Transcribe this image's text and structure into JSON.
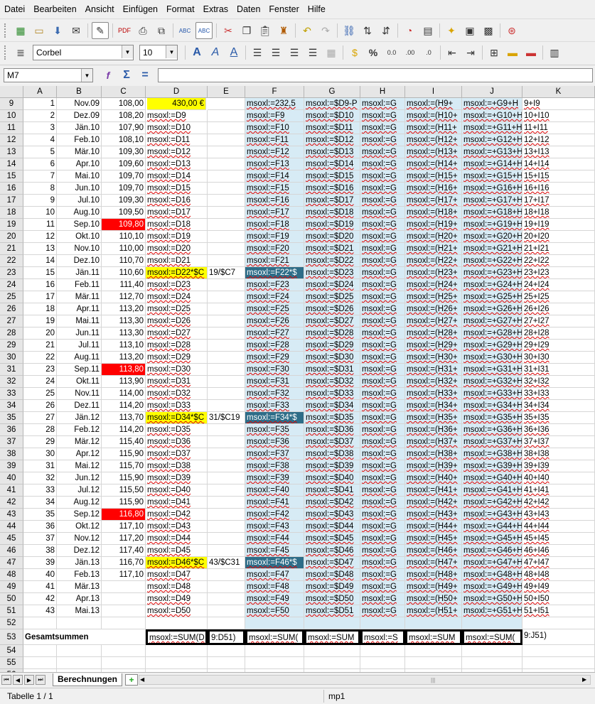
{
  "menu": [
    "Datei",
    "Bearbeiten",
    "Ansicht",
    "Einfügen",
    "Format",
    "Extras",
    "Daten",
    "Fenster",
    "Hilfe"
  ],
  "font_name": "Corbel",
  "font_size": "10",
  "name_box": "M7",
  "formula": "",
  "columns": [
    "A",
    "B",
    "C",
    "D",
    "E",
    "F",
    "G",
    "H",
    "I",
    "J",
    "K"
  ],
  "rows": [
    {
      "n": "9",
      "a": "1",
      "b": "Nov.09",
      "c": "108,00",
      "d": "430,00 €",
      "f": "msoxl:=232,5",
      "g": "msoxl:=$D9-P",
      "h": "msoxl:=G",
      "i": "msoxl:=(H9+",
      "j": "msoxl:=+G9+H",
      "k": "9+I9"
    },
    {
      "n": "10",
      "a": "2",
      "b": "Dez.09",
      "c": "108,20",
      "d": "msoxl:=D9",
      "f": "msoxl:=F9",
      "g": "msoxl:=$D10",
      "h": "msoxl:=G",
      "i": "msoxl:=(H10+",
      "j": "msoxl:=+G10+H",
      "k": "10+I10"
    },
    {
      "n": "11",
      "a": "3",
      "b": "Jän.10",
      "c": "107,90",
      "d": "msoxl:=D10",
      "f": "msoxl:=F10",
      "g": "msoxl:=$D11",
      "h": "msoxl:=G",
      "i": "msoxl:=(H11+",
      "j": "msoxl:=+G11+H",
      "k": "11+I11"
    },
    {
      "n": "12",
      "a": "4",
      "b": "Feb.10",
      "c": "108,10",
      "d": "msoxl:=D11",
      "f": "msoxl:=F11",
      "g": "msoxl:=$D12",
      "h": "msoxl:=G",
      "i": "msoxl:=(H12+",
      "j": "msoxl:=+G12+H",
      "k": "12+I12"
    },
    {
      "n": "13",
      "a": "5",
      "b": "Mär.10",
      "c": "109,30",
      "d": "msoxl:=D12",
      "f": "msoxl:=F12",
      "g": "msoxl:=$D13",
      "h": "msoxl:=G",
      "i": "msoxl:=(H13+",
      "j": "msoxl:=+G13+H",
      "k": "13+I13"
    },
    {
      "n": "14",
      "a": "6",
      "b": "Apr.10",
      "c": "109,60",
      "d": "msoxl:=D13",
      "f": "msoxl:=F13",
      "g": "msoxl:=$D14",
      "h": "msoxl:=G",
      "i": "msoxl:=(H14+",
      "j": "msoxl:=+G14+H",
      "k": "14+I14"
    },
    {
      "n": "15",
      "a": "7",
      "b": "Mai.10",
      "c": "109,70",
      "d": "msoxl:=D14",
      "f": "msoxl:=F14",
      "g": "msoxl:=$D15",
      "h": "msoxl:=G",
      "i": "msoxl:=(H15+",
      "j": "msoxl:=+G15+H",
      "k": "15+I15"
    },
    {
      "n": "16",
      "a": "8",
      "b": "Jun.10",
      "c": "109,70",
      "d": "msoxl:=D15",
      "f": "msoxl:=F15",
      "g": "msoxl:=$D16",
      "h": "msoxl:=G",
      "i": "msoxl:=(H16+",
      "j": "msoxl:=+G16+H",
      "k": "16+I16"
    },
    {
      "n": "17",
      "a": "9",
      "b": "Jul.10",
      "c": "109,30",
      "d": "msoxl:=D16",
      "f": "msoxl:=F16",
      "g": "msoxl:=$D17",
      "h": "msoxl:=G",
      "i": "msoxl:=(H17+",
      "j": "msoxl:=+G17+H",
      "k": "17+I17"
    },
    {
      "n": "18",
      "a": "10",
      "b": "Aug.10",
      "c": "109,50",
      "d": "msoxl:=D17",
      "f": "msoxl:=F17",
      "g": "msoxl:=$D18",
      "h": "msoxl:=G",
      "i": "msoxl:=(H18+",
      "j": "msoxl:=+G18+H",
      "k": "18+I18"
    },
    {
      "n": "19",
      "a": "11",
      "b": "Sep.10",
      "c": "109,80",
      "cred": true,
      "d": "msoxl:=D18",
      "f": "msoxl:=F18",
      "g": "msoxl:=$D19",
      "h": "msoxl:=G",
      "i": "msoxl:=(H19+",
      "j": "msoxl:=+G19+H",
      "k": "19+I19"
    },
    {
      "n": "20",
      "a": "12",
      "b": "Okt.10",
      "c": "110,10",
      "d": "msoxl:=D19",
      "f": "msoxl:=F19",
      "g": "msoxl:=$D20",
      "h": "msoxl:=G",
      "i": "msoxl:=(H20+",
      "j": "msoxl:=+G20+H",
      "k": "20+I20"
    },
    {
      "n": "21",
      "a": "13",
      "b": "Nov.10",
      "c": "110,00",
      "d": "msoxl:=D20",
      "f": "msoxl:=F20",
      "g": "msoxl:=$D21",
      "h": "msoxl:=G",
      "i": "msoxl:=(H21+",
      "j": "msoxl:=+G21+H",
      "k": "21+I21"
    },
    {
      "n": "22",
      "a": "14",
      "b": "Dez.10",
      "c": "110,70",
      "d": "msoxl:=D21",
      "f": "msoxl:=F21",
      "g": "msoxl:=$D22",
      "h": "msoxl:=G",
      "i": "msoxl:=(H22+",
      "j": "msoxl:=+G22+H",
      "k": "22+I22"
    },
    {
      "n": "23",
      "a": "15",
      "b": "Jän.11",
      "c": "110,60",
      "d": "msoxl:=D22*$C",
      "dyel": true,
      "e": "19/$C7",
      "f": "msoxl:=F22*$",
      "fdk": true,
      "g": "msoxl:=$D23",
      "h": "msoxl:=G",
      "i": "msoxl:=(H23+",
      "j": "msoxl:=+G23+H",
      "k": "23+I23"
    },
    {
      "n": "24",
      "a": "16",
      "b": "Feb.11",
      "c": "111,40",
      "d": "msoxl:=D23",
      "f": "msoxl:=F23",
      "g": "msoxl:=$D24",
      "h": "msoxl:=G",
      "i": "msoxl:=(H24+",
      "j": "msoxl:=+G24+H",
      "k": "24+I24"
    },
    {
      "n": "25",
      "a": "17",
      "b": "Mär.11",
      "c": "112,70",
      "d": "msoxl:=D24",
      "f": "msoxl:=F24",
      "g": "msoxl:=$D25",
      "h": "msoxl:=G",
      "i": "msoxl:=(H25+",
      "j": "msoxl:=+G25+H",
      "k": "25+I25"
    },
    {
      "n": "26",
      "a": "18",
      "b": "Apr.11",
      "c": "113,20",
      "d": "msoxl:=D25",
      "f": "msoxl:=F25",
      "g": "msoxl:=$D26",
      "h": "msoxl:=G",
      "i": "msoxl:=(H26+",
      "j": "msoxl:=+G26+H",
      "k": "26+I26"
    },
    {
      "n": "27",
      "a": "19",
      "b": "Mai.11",
      "c": "113,30",
      "d": "msoxl:=D26",
      "f": "msoxl:=F26",
      "g": "msoxl:=$D27",
      "h": "msoxl:=G",
      "i": "msoxl:=(H27+",
      "j": "msoxl:=+G27+H",
      "k": "27+I27"
    },
    {
      "n": "28",
      "a": "20",
      "b": "Jun.11",
      "c": "113,30",
      "d": "msoxl:=D27",
      "f": "msoxl:=F27",
      "g": "msoxl:=$D28",
      "h": "msoxl:=G",
      "i": "msoxl:=(H28+",
      "j": "msoxl:=+G28+H",
      "k": "28+I28"
    },
    {
      "n": "29",
      "a": "21",
      "b": "Jul.11",
      "c": "113,10",
      "d": "msoxl:=D28",
      "f": "msoxl:=F28",
      "g": "msoxl:=$D29",
      "h": "msoxl:=G",
      "i": "msoxl:=(H29+",
      "j": "msoxl:=+G29+H",
      "k": "29+I29"
    },
    {
      "n": "30",
      "a": "22",
      "b": "Aug.11",
      "c": "113,20",
      "d": "msoxl:=D29",
      "f": "msoxl:=F29",
      "g": "msoxl:=$D30",
      "h": "msoxl:=G",
      "i": "msoxl:=(H30+",
      "j": "msoxl:=+G30+H",
      "k": "30+I30"
    },
    {
      "n": "31",
      "a": "23",
      "b": "Sep.11",
      "c": "113,80",
      "cred": true,
      "d": "msoxl:=D30",
      "f": "msoxl:=F30",
      "g": "msoxl:=$D31",
      "h": "msoxl:=G",
      "i": "msoxl:=(H31+",
      "j": "msoxl:=+G31+H",
      "k": "31+I31"
    },
    {
      "n": "32",
      "a": "24",
      "b": "Okt.11",
      "c": "113,90",
      "d": "msoxl:=D31",
      "f": "msoxl:=F31",
      "g": "msoxl:=$D32",
      "h": "msoxl:=G",
      "i": "msoxl:=(H32+",
      "j": "msoxl:=+G32+H",
      "k": "32+I32"
    },
    {
      "n": "33",
      "a": "25",
      "b": "Nov.11",
      "c": "114,00",
      "d": "msoxl:=D32",
      "f": "msoxl:=F32",
      "g": "msoxl:=$D33",
      "h": "msoxl:=G",
      "i": "msoxl:=(H33+",
      "j": "msoxl:=+G33+H",
      "k": "33+I33"
    },
    {
      "n": "34",
      "a": "26",
      "b": "Dez.11",
      "c": "114,20",
      "d": "msoxl:=D33",
      "f": "msoxl:=F33",
      "g": "msoxl:=$D34",
      "h": "msoxl:=G",
      "i": "msoxl:=(H34+",
      "j": "msoxl:=+G34+H",
      "k": "34+I34"
    },
    {
      "n": "35",
      "a": "27",
      "b": "Jän.12",
      "c": "113,70",
      "d": "msoxl:=D34*$C",
      "dyel": true,
      "e": "31/$C19",
      "f": "msoxl:=F34*$",
      "fdk": true,
      "g": "msoxl:=$D35",
      "h": "msoxl:=G",
      "i": "msoxl:=(H35+",
      "j": "msoxl:=+G35+H",
      "k": "35+I35"
    },
    {
      "n": "36",
      "a": "28",
      "b": "Feb.12",
      "c": "114,20",
      "d": "msoxl:=D35",
      "f": "msoxl:=F35",
      "g": "msoxl:=$D36",
      "h": "msoxl:=G",
      "i": "msoxl:=(H36+",
      "j": "msoxl:=+G36+H",
      "k": "36+I36"
    },
    {
      "n": "37",
      "a": "29",
      "b": "Mär.12",
      "c": "115,40",
      "d": "msoxl:=D36",
      "f": "msoxl:=F36",
      "g": "msoxl:=$D37",
      "h": "msoxl:=G",
      "i": "msoxl:=(H37+",
      "j": "msoxl:=+G37+H",
      "k": "37+I37"
    },
    {
      "n": "38",
      "a": "30",
      "b": "Apr.12",
      "c": "115,90",
      "d": "msoxl:=D37",
      "f": "msoxl:=F37",
      "g": "msoxl:=$D38",
      "h": "msoxl:=G",
      "i": "msoxl:=(H38+",
      "j": "msoxl:=+G38+H",
      "k": "38+I38"
    },
    {
      "n": "39",
      "a": "31",
      "b": "Mai.12",
      "c": "115,70",
      "d": "msoxl:=D38",
      "f": "msoxl:=F38",
      "g": "msoxl:=$D39",
      "h": "msoxl:=G",
      "i": "msoxl:=(H39+",
      "j": "msoxl:=+G39+H",
      "k": "39+I39"
    },
    {
      "n": "40",
      "a": "32",
      "b": "Jun.12",
      "c": "115,90",
      "d": "msoxl:=D39",
      "f": "msoxl:=F39",
      "g": "msoxl:=$D40",
      "h": "msoxl:=G",
      "i": "msoxl:=(H40+",
      "j": "msoxl:=+G40+H",
      "k": "40+I40"
    },
    {
      "n": "41",
      "a": "33",
      "b": "Jul.12",
      "c": "115,50",
      "d": "msoxl:=D40",
      "f": "msoxl:=F40",
      "g": "msoxl:=$D41",
      "h": "msoxl:=G",
      "i": "msoxl:=(H41+",
      "j": "msoxl:=+G41+H",
      "k": "41+I41"
    },
    {
      "n": "42",
      "a": "34",
      "b": "Aug.12",
      "c": "115,90",
      "d": "msoxl:=D41",
      "f": "msoxl:=F41",
      "g": "msoxl:=$D42",
      "h": "msoxl:=G",
      "i": "msoxl:=(H42+",
      "j": "msoxl:=+G42+H",
      "k": "42+I42"
    },
    {
      "n": "43",
      "a": "35",
      "b": "Sep.12",
      "c": "116,80",
      "cred": true,
      "d": "msoxl:=D42",
      "f": "msoxl:=F42",
      "g": "msoxl:=$D43",
      "h": "msoxl:=G",
      "i": "msoxl:=(H43+",
      "j": "msoxl:=+G43+H",
      "k": "43+I43"
    },
    {
      "n": "44",
      "a": "36",
      "b": "Okt.12",
      "c": "117,10",
      "d": "msoxl:=D43",
      "f": "msoxl:=F43",
      "g": "msoxl:=$D44",
      "h": "msoxl:=G",
      "i": "msoxl:=(H44+",
      "j": "msoxl:=+G44+H",
      "k": "44+I44"
    },
    {
      "n": "45",
      "a": "37",
      "b": "Nov.12",
      "c": "117,20",
      "d": "msoxl:=D44",
      "f": "msoxl:=F44",
      "g": "msoxl:=$D45",
      "h": "msoxl:=G",
      "i": "msoxl:=(H45+",
      "j": "msoxl:=+G45+H",
      "k": "45+I45"
    },
    {
      "n": "46",
      "a": "38",
      "b": "Dez.12",
      "c": "117,40",
      "d": "msoxl:=D45",
      "f": "msoxl:=F45",
      "g": "msoxl:=$D46",
      "h": "msoxl:=G",
      "i": "msoxl:=(H46+",
      "j": "msoxl:=+G46+H",
      "k": "46+I46"
    },
    {
      "n": "47",
      "a": "39",
      "b": "Jän.13",
      "c": "116,70",
      "d": "msoxl:=D46*$C",
      "dyel": true,
      "e": "43/$C31",
      "f": "msoxl:=F46*$",
      "fdk": true,
      "g": "msoxl:=$D47",
      "h": "msoxl:=G",
      "i": "msoxl:=(H47+",
      "j": "msoxl:=+G47+H",
      "k": "47+I47"
    },
    {
      "n": "48",
      "a": "40",
      "b": "Feb.13",
      "c": "117,10",
      "d": "msoxl:=D47",
      "f": "msoxl:=F47",
      "g": "msoxl:=$D48",
      "h": "msoxl:=G",
      "i": "msoxl:=(H48+",
      "j": "msoxl:=+G48+H",
      "k": "48+I48"
    },
    {
      "n": "49",
      "a": "41",
      "b": "Mär.13",
      "c": "",
      "d": "msoxl:=D48",
      "f": "msoxl:=F48",
      "g": "msoxl:=$D49",
      "h": "msoxl:=G",
      "i": "msoxl:=(H49+",
      "j": "msoxl:=+G49+H",
      "k": "49+I49"
    },
    {
      "n": "50",
      "a": "42",
      "b": "Apr.13",
      "c": "",
      "d": "msoxl:=D49",
      "f": "msoxl:=F49",
      "g": "msoxl:=$D50",
      "h": "msoxl:=G",
      "i": "msoxl:=(H50+",
      "j": "msoxl:=+G50+H",
      "k": "50+I50"
    },
    {
      "n": "51",
      "a": "43",
      "b": "Mai.13",
      "c": "",
      "d": "msoxl:=D50",
      "f": "msoxl:=F50",
      "g": "msoxl:=$D51",
      "h": "msoxl:=G",
      "i": "msoxl:=(H51+",
      "j": "msoxl:=+G51+H",
      "k": "51+I51"
    }
  ],
  "row52": "52",
  "row53": {
    "n": "53",
    "label": "Gesamtsummen",
    "d": "msoxl:=SUM(D",
    "e": "9:D51)",
    "f": "msoxl:=SUM(",
    "g": "msoxl:=SUM",
    "h": "msoxl:=S",
    "i": "msoxl:=SUM",
    "j": "msoxl:=SUM(",
    "k": "9:J51)"
  },
  "row54": "54",
  "row55": "55",
  "row56": "56",
  "sheet_tab": "Berechnungen",
  "status_left": "Tabelle 1 / 1",
  "status_mid": "mp1"
}
